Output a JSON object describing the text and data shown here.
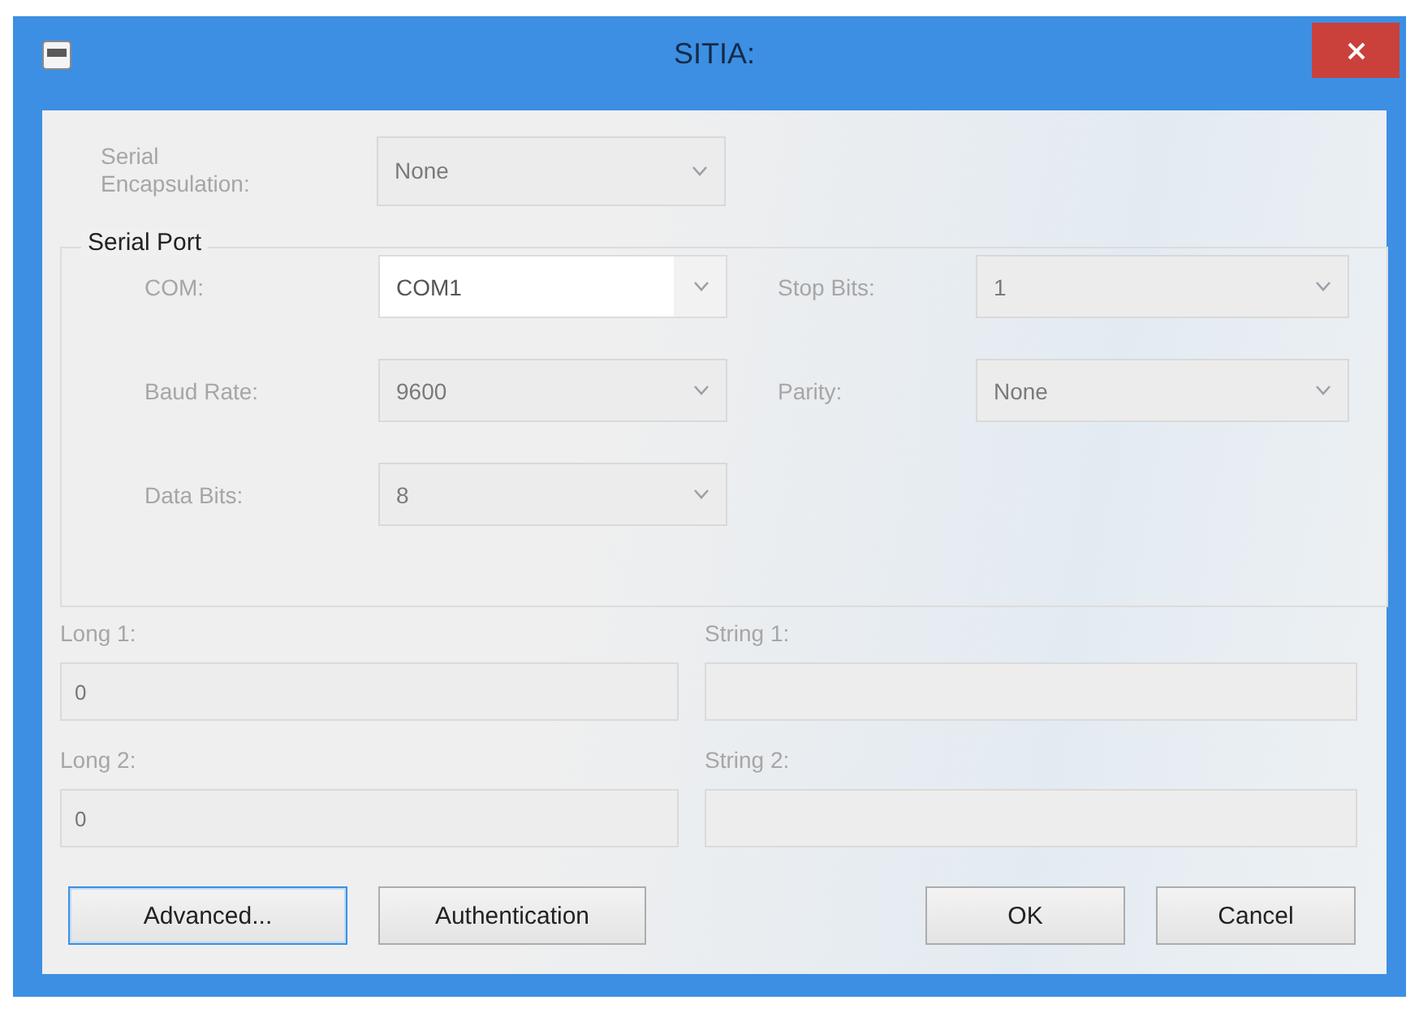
{
  "window": {
    "title": "SITIA:"
  },
  "encapsulation": {
    "label": "Serial Encapsulation:",
    "value": "None",
    "disabled": true
  },
  "serial_port": {
    "title": "Serial Port",
    "fields": [
      {
        "label": "COM:",
        "value": "COM1",
        "disabled": false
      },
      {
        "label": "Stop Bits:",
        "value": "1",
        "disabled": true
      },
      {
        "label": "Baud Rate:",
        "value": "9600",
        "disabled": true
      },
      {
        "label": "Parity:",
        "value": "None",
        "disabled": true
      },
      {
        "label": "Data Bits:",
        "value": "8",
        "disabled": true
      }
    ]
  },
  "text_fields": [
    {
      "label": "Long 1:",
      "value": "0",
      "disabled": true
    },
    {
      "label": "String 1:",
      "disabled": true
    },
    {
      "label": "Long 2:",
      "value": "0",
      "disabled": true
    },
    {
      "label": "String 2:",
      "disabled": true
    }
  ],
  "buttons": {
    "left": [
      {
        "label": "Advanced...",
        "focused": true
      },
      {
        "label": "Authentication",
        "focused": false
      }
    ],
    "right": [
      {
        "label": "OK",
        "focused": false
      },
      {
        "label": "Cancel",
        "focused": false
      }
    ]
  }
}
